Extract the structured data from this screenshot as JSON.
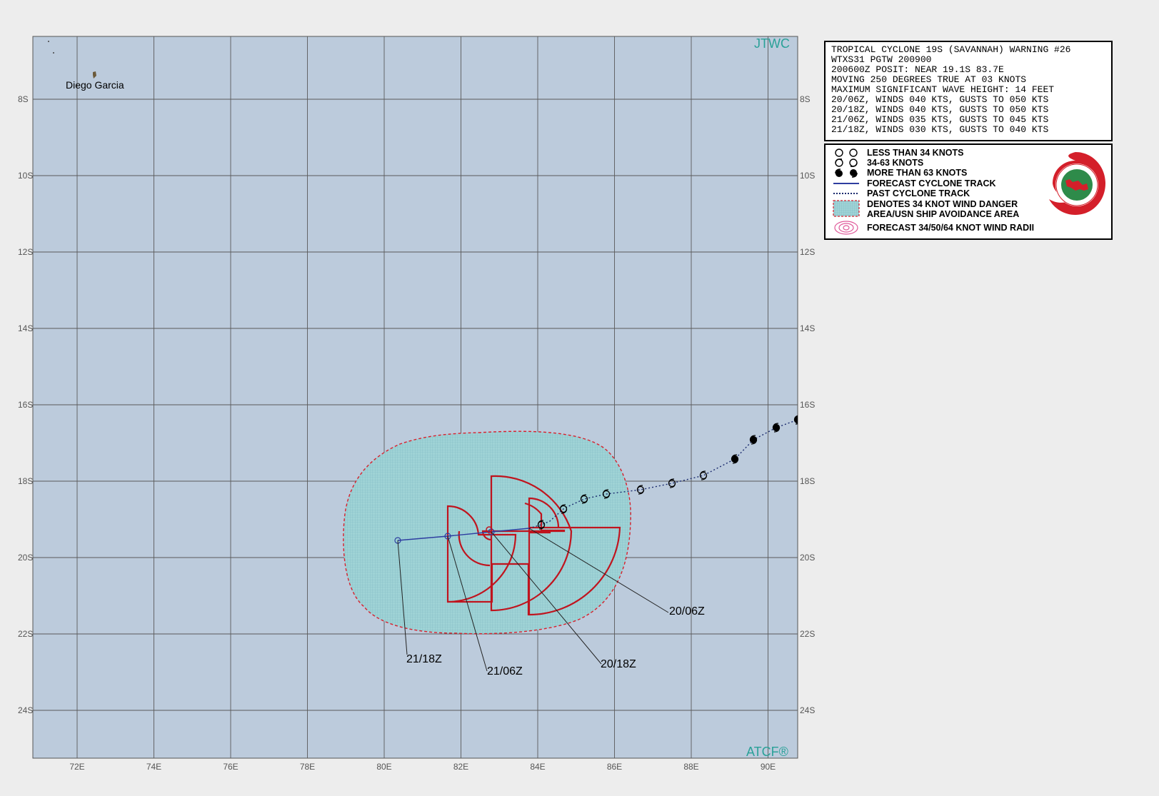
{
  "map": {
    "top_right_label": "JTWC",
    "bottom_right_label": "ATCF®",
    "place_labels": [
      "Diego Garcia"
    ],
    "lon_labels": [
      "72E",
      "74E",
      "76E",
      "78E",
      "80E",
      "82E",
      "84E",
      "86E",
      "88E",
      "90E"
    ],
    "lat_labels": [
      "8S",
      "10S",
      "12S",
      "14S",
      "16S",
      "18S",
      "20S",
      "22S",
      "24S"
    ],
    "forecast_time_labels": [
      "20/06Z",
      "20/18Z",
      "21/06Z",
      "21/18Z"
    ],
    "colors": {
      "ocean": "#bccbdc",
      "grid": "#5a5a5a",
      "danger_area_fill": "#9fd3d6",
      "danger_area_border": "#d8202c",
      "wind_radii": "#c0141e",
      "forecast_track": "#2e3da0",
      "past_track": "#1b2b6e"
    }
  },
  "forecast_points": [
    {
      "time": "20/06Z",
      "lat": -19.1,
      "lon": 83.7
    },
    {
      "time": "20/18Z",
      "lat": -19.2,
      "lon": 82.7
    },
    {
      "time": "21/06Z",
      "lat": -19.3,
      "lon": 81.6
    },
    {
      "time": "21/18Z",
      "lat": -19.4,
      "lon": 80.3
    }
  ],
  "warning": {
    "lines": [
      "TROPICAL CYCLONE 19S (SAVANNAH) WARNING #26",
      "WTXS31 PGTW 200900",
      "200600Z POSIT: NEAR 19.1S 83.7E",
      "MOVING 250 DEGREES TRUE AT 03 KNOTS",
      "MAXIMUM SIGNIFICANT WAVE HEIGHT: 14 FEET",
      "20/06Z, WINDS 040 KTS, GUSTS TO 050 KTS",
      "20/18Z, WINDS 040 KTS, GUSTS TO 050 KTS",
      "21/06Z, WINDS 035 KTS, GUSTS TO 045 KTS",
      "21/18Z, WINDS 030 KTS, GUSTS TO 040 KTS"
    ]
  },
  "legend": {
    "items": [
      {
        "label": "LESS THAN 34 KNOTS",
        "symbol": "tc-symbol-open-icon"
      },
      {
        "label": "34-63 KNOTS",
        "symbol": "tc-symbol-half-icon"
      },
      {
        "label": "MORE THAN 63 KNOTS",
        "symbol": "tc-symbol-filled-icon"
      },
      {
        "label": "FORECAST CYCLONE TRACK",
        "symbol": "solid-line-icon"
      },
      {
        "label": "PAST CYCLONE TRACK",
        "symbol": "dotted-line-icon"
      },
      {
        "label": "DENOTES 34 KNOT WIND DANGER",
        "symbol": "danger-area-icon"
      },
      {
        "label": "AREA/USN SHIP AVOIDANCE AREA",
        "symbol": ""
      },
      {
        "label": "FORECAST 34/50/64 KNOT WIND RADII",
        "symbol": "wind-radii-icon"
      }
    ],
    "seal_name": "jtwc-seal-icon"
  }
}
